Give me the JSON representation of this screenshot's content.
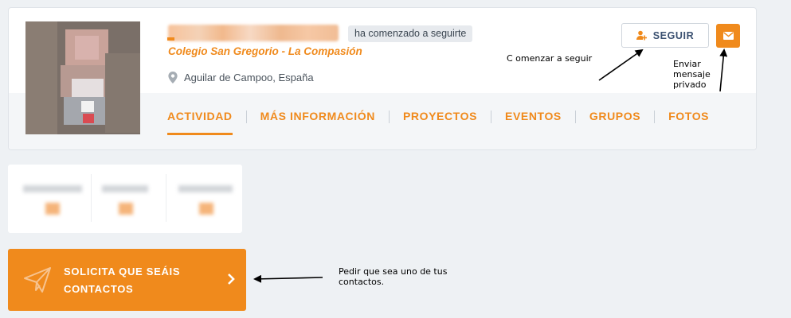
{
  "profile": {
    "follow_badge": "ha comenzado a seguirte",
    "school": "Colegio San Gregorio - La Compasión",
    "location": "Aguilar de Campoo, España"
  },
  "actions": {
    "follow_label": "SEGUIR",
    "follow_icon": "user-plus-icon",
    "message_icon": "envelope-icon"
  },
  "tabs": [
    {
      "label": "ACTIVIDAD",
      "active": true
    },
    {
      "label": "MÁS INFORMACIÓN",
      "active": false
    },
    {
      "label": "PROYECTOS",
      "active": false
    },
    {
      "label": "EVENTOS",
      "active": false
    },
    {
      "label": "GRUPOS",
      "active": false
    },
    {
      "label": "FOTOS",
      "active": false
    }
  ],
  "request_contact": {
    "label": "SOLICITA QUE SEÁIS CONTACTOS",
    "icon": "paper-plane-icon"
  },
  "annotations": {
    "follow": "C omenzar a seguir",
    "message": "Enviar mensaje privado",
    "request": "Pedir que sea uno de tus contactos."
  },
  "colors": {
    "accent": "#f08a1c",
    "background": "#eef1f4",
    "card": "#ffffff",
    "follow_text": "#3a5070"
  }
}
